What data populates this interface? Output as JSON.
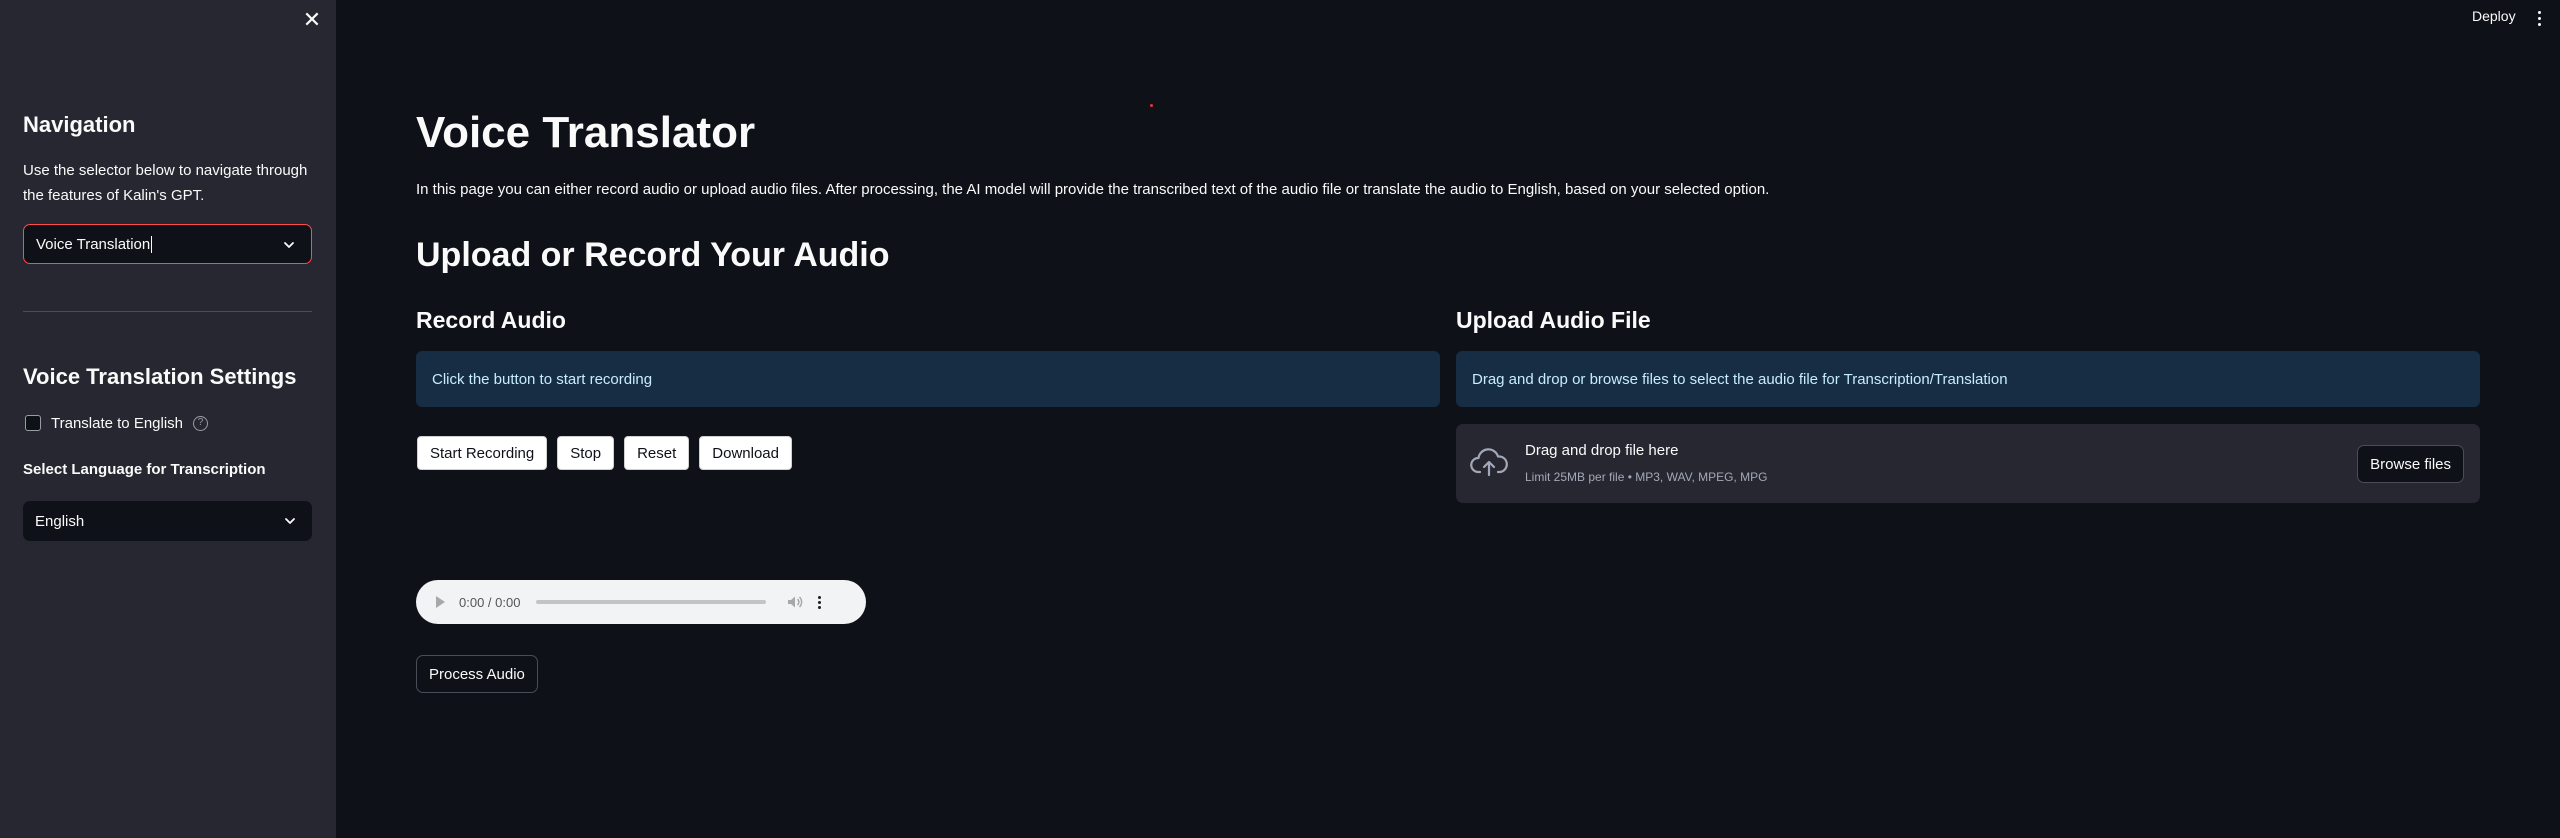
{
  "sidebar": {
    "close_icon": "close-icon",
    "nav_title": "Navigation",
    "nav_desc_line1": "Use the selector below to navigate through",
    "nav_desc_line2": "the features of Kalin's GPT.",
    "nav_select_value": "Voice Translation",
    "vt_settings_title": "Voice Translation Settings",
    "translate_label": "Translate to English",
    "translate_checked": false,
    "lang_label": "Select Language for Transcription",
    "lang_select_value": "English"
  },
  "header": {
    "deploy_label": "Deploy",
    "menu_icon": "more-vertical-icon"
  },
  "main": {
    "title": "Voice Translator",
    "description": "In this page you can either record audio or upload audio files. After processing, the AI model will provide the transcribed text of the audio file or translate the audio to English, based on your selected option.",
    "section_title": "Upload or Record Your Audio",
    "record": {
      "title": "Record Audio",
      "info": "Click the button to start recording",
      "buttons": [
        "Start Recording",
        "Stop",
        "Reset",
        "Download"
      ]
    },
    "upload": {
      "title": "Upload Audio File",
      "info": "Drag and drop or browse files to select the audio file for Transcription/Translation",
      "drop_text": "Drag and drop file here",
      "limit_text": "Limit 25MB per file • MP3, WAV, MPEG, MPG",
      "browse_label": "Browse files"
    },
    "audio_player": {
      "time": "0:00 / 0:00",
      "progress": 0
    },
    "process_label": "Process Audio"
  },
  "colors": {
    "background": "#0e1117",
    "sidebar": "#262730",
    "accent": "#ff4b4b",
    "info_bg": "#172d43",
    "info_text": "#c7ebff"
  }
}
